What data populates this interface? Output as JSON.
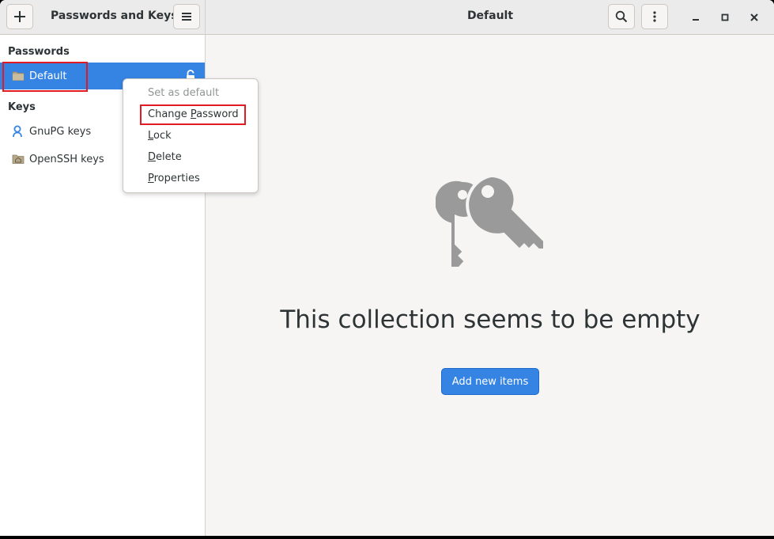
{
  "headerbar": {
    "app_title": "Passwords and Keys",
    "view_title": "Default"
  },
  "sidebar": {
    "passwords_heading": "Passwords",
    "keys_heading": "Keys",
    "items": [
      {
        "label": "Default",
        "icon": "folder-icon",
        "selected": true,
        "locked": false
      },
      {
        "label": "GnuPG keys",
        "icon": "gnupg-person-icon"
      },
      {
        "label": "OpenSSH keys",
        "icon": "home-folder-icon"
      }
    ]
  },
  "context_menu": {
    "items": [
      {
        "pre": "Set as default",
        "ul": "",
        "post": "",
        "disabled": true
      },
      {
        "pre": "Change ",
        "ul": "P",
        "post": "assword",
        "disabled": false
      },
      {
        "pre": "",
        "ul": "L",
        "post": "ock",
        "disabled": false
      },
      {
        "pre": "",
        "ul": "D",
        "post": "elete",
        "disabled": false
      },
      {
        "pre": "",
        "ul": "P",
        "post": "roperties",
        "disabled": false
      }
    ]
  },
  "main": {
    "empty_message": "This collection seems to be empty",
    "add_button": "Add new items"
  },
  "colors": {
    "accent": "#3584e4",
    "highlight": "#e01b24",
    "icon_gray": "#9a9a9a"
  }
}
